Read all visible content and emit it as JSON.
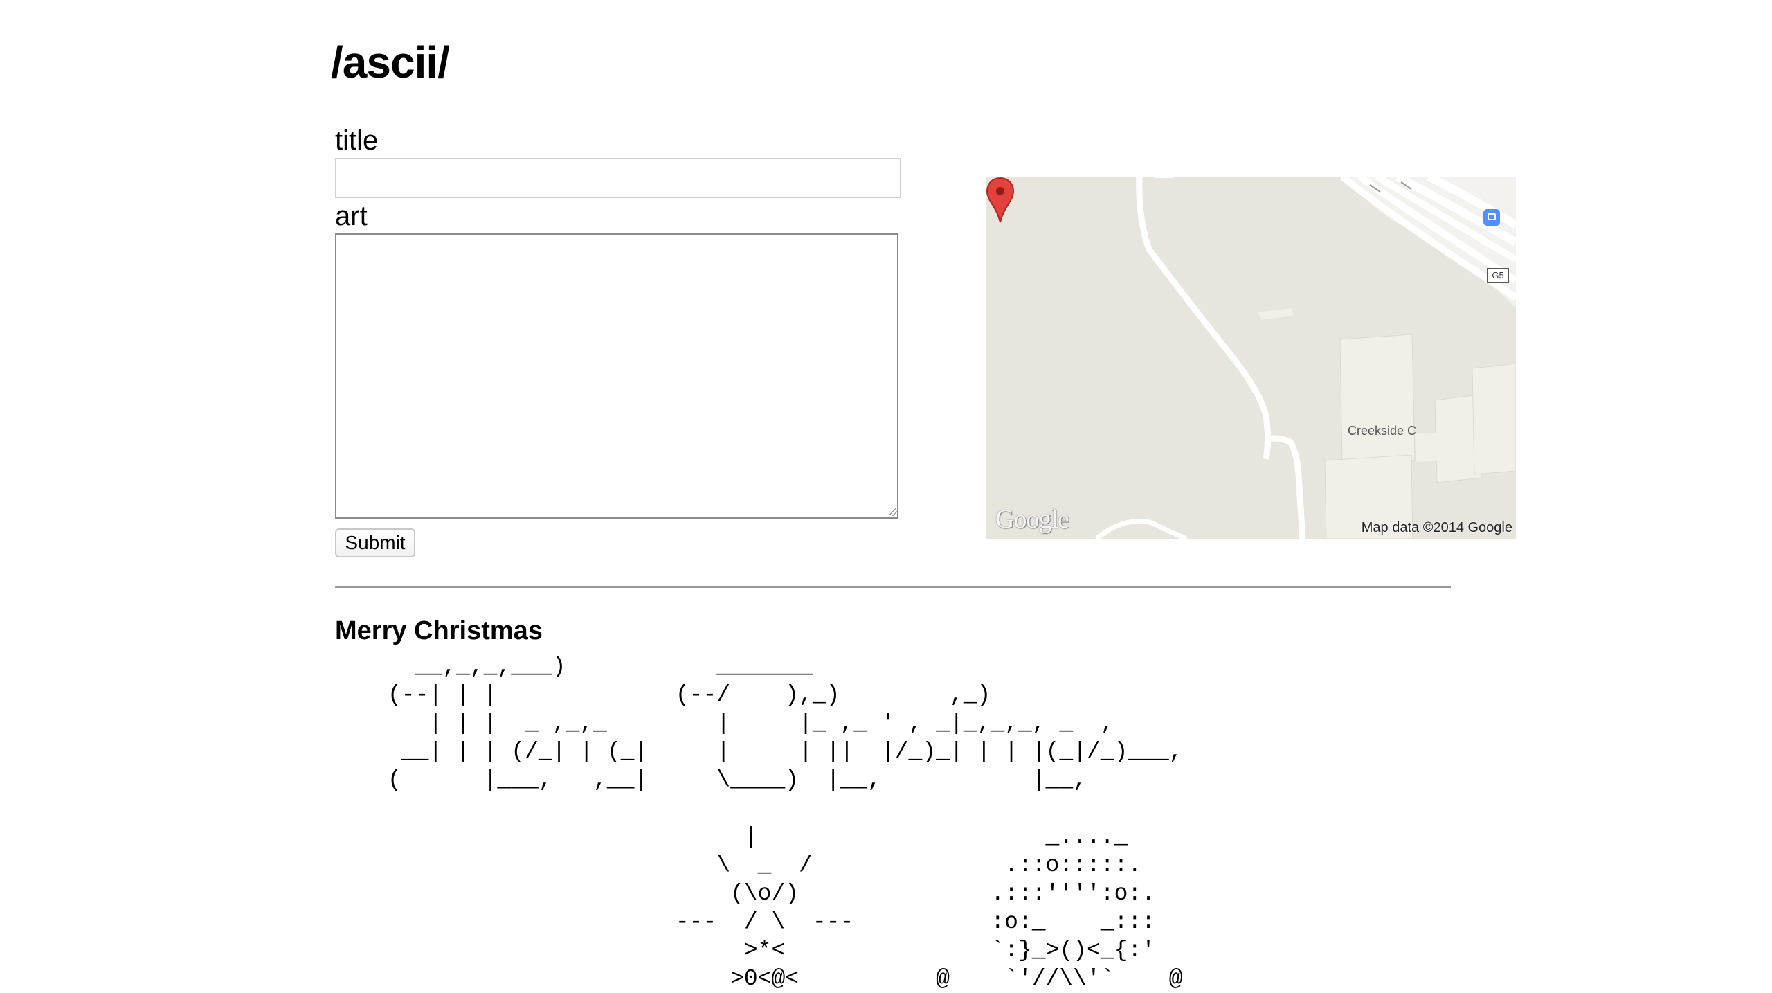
{
  "page": {
    "title": "/ascii/"
  },
  "form": {
    "title_label": "title",
    "title_value": "",
    "art_label": "art",
    "art_value": "",
    "submit_label": "Submit"
  },
  "map": {
    "place_label": "Creekside C",
    "attribution": "Map data ©2014 Google",
    "logo": "Google",
    "route_label": "G5",
    "icons": {
      "pin": "map-marker-icon",
      "transit": "transit-icon",
      "route": "route-shield-icon"
    },
    "colors": {
      "background": "#e8e5df",
      "road": "#ffffff",
      "building": "#f2efe9",
      "pin": "#e2423b"
    }
  },
  "posts": [
    {
      "title": "Merry Christmas",
      "art": "  __,_,_,___)           _______\n(--| | |             (--/    ),_)        ,_)\n   | | |  _ ,_,_        |     |_ ,_ ' , _|_,_,_, _  ,\n __| | | (/_| | (_|     |     | ||  |/_)_| | | |(_|/_)___,\n(      |___,   ,__|     \\____)  |__,           |__,\n\n                          |                     _...._\n                        \\  _  /              .::o:::::.\n                         (\\o/)              .:::'''':o:.\n                     ---  / \\  ---          :o:_    _:::\n                          >*<               `:}_>()<_{:'\n                         >0<@<          @    `'//\\\\'`    @"
    }
  ]
}
